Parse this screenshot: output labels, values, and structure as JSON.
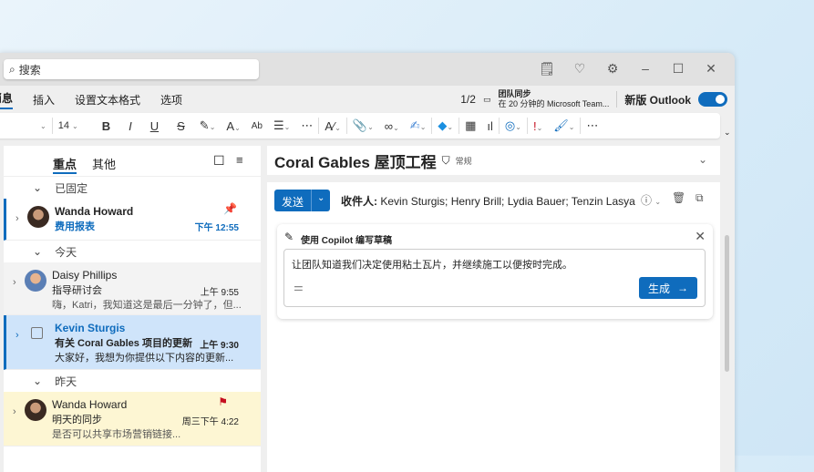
{
  "search": {
    "placeholder": "搜索"
  },
  "titlebar": {
    "icons": [
      "todo-icon",
      "lightbulb-icon",
      "gear-icon",
      "minimize-icon",
      "maximize-icon",
      "close-icon"
    ]
  },
  "ribbon": {
    "tabs": [
      "消息",
      "插入",
      "设置文本格式",
      "选项"
    ],
    "active": "消息",
    "meeting_count": "1/2",
    "meeting_title": "团队同步",
    "meeting_time": "在 20 分钟的 Microsoft Team...",
    "new_outlook": "新版 Outlook",
    "new_outlook_on": true
  },
  "toolbar": {
    "font_size": "14"
  },
  "list": {
    "tabs": [
      "重点",
      "其他"
    ],
    "groups": [
      "已固定",
      "今天",
      "昨天"
    ],
    "items": [
      {
        "name": "Wanda Howard",
        "subject": "费用报表",
        "time": "下午 12:55",
        "preview": "",
        "pinned": true
      },
      {
        "name": "Daisy Phillips",
        "subject": "指导研讨会",
        "time": "上午 9:55",
        "preview": "嗨，Katri，我知道这是最后一分钟了，但..."
      },
      {
        "name": "Kevin Sturgis",
        "subject": "有关 Coral Gables 项目的更新",
        "time": "上午 9:30",
        "preview": "大家好，我想为你提供以下内容的更新...",
        "selected": true
      },
      {
        "name": "Wanda Howard",
        "subject": "明天的同步",
        "time": "周三下午 4:22",
        "preview": "是否可以共享市场营销链接...",
        "flagged": true
      }
    ]
  },
  "reading": {
    "subject": "Coral Gables 屋顶工程",
    "sensitivity": "常规",
    "send": "发送",
    "to_label": "收件人:",
    "to": "Kevin Sturgis; Henry Brill; Lydia Bauer; Tenzin Lasya",
    "copilot": {
      "title": "使用 Copilot 编写草稿",
      "prompt": "让团队知道我们决定使用粘土瓦片，并继续施工以便按时完成。",
      "generate": "生成"
    }
  },
  "colors": {
    "accent": "#0f6cbd",
    "selected": "#cfe4fa",
    "flagged_bg": "#fdf6d3",
    "flag": "#c50f1f"
  }
}
